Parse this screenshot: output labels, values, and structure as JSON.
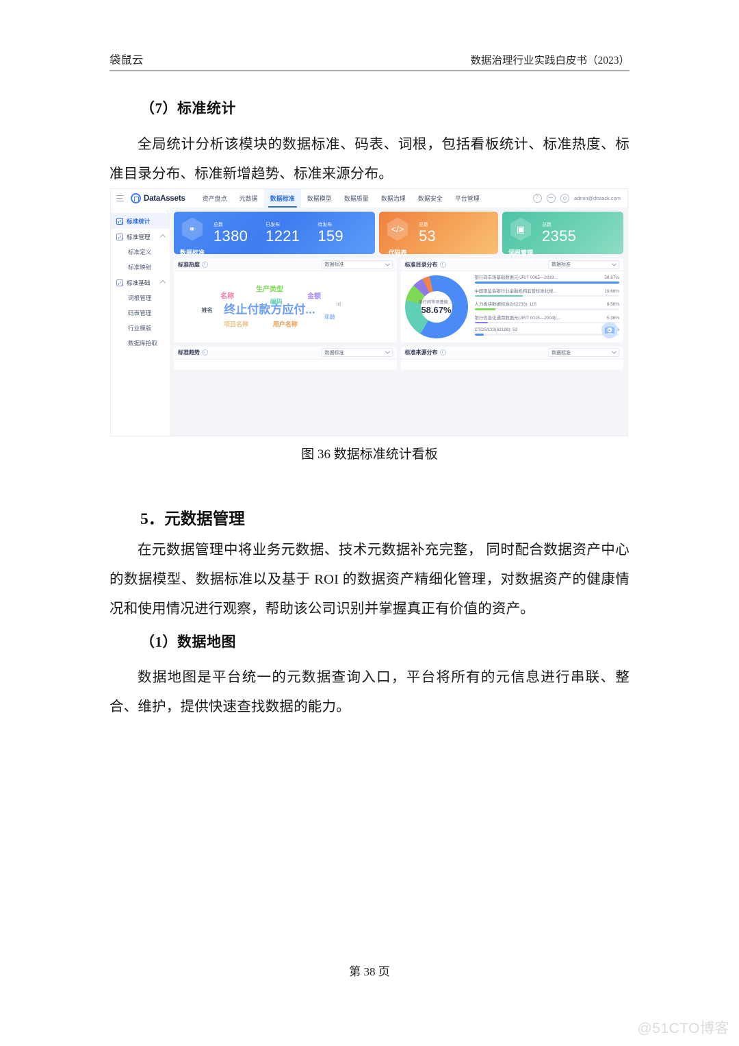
{
  "page": {
    "header_left": "袋鼠云",
    "header_right": "数据治理行业实践白皮书（2023）",
    "footer": "第 38 页",
    "watermark": "@51CTO博客"
  },
  "sections": {
    "sub_heading_7": "（7）标准统计",
    "para_7": "全局统计分析该模块的数据标准、码表、词根，包括看板统计、标准热度、标准目录分布、标准新增趋势、标准来源分布。",
    "figure_caption": "图 36 数据标准统计看板",
    "heading_5": "5．元数据管理",
    "para_5": "在元数据管理中将业务元数据、技术元数据补充完整， 同时配合数据资产中心的数据模型、数据标准以及基于 ROI 的数据资产精细化管理，对数据资产的健康情况和使用情况进行观察，帮助该公司识别并掌握真正有价值的资产。",
    "sub_heading_1": "（1）数据地图",
    "para_1": "数据地图是平台统一的元数据查询入口，平台将所有的元信息进行串联、整合、维护，提供快速查找数据的能力。"
  },
  "app": {
    "brand": "DataAssets",
    "nav_tabs": [
      {
        "label": "资产盘点",
        "active": false
      },
      {
        "label": "元数据",
        "active": false
      },
      {
        "label": "数据标准",
        "active": true
      },
      {
        "label": "数据模型",
        "active": false
      },
      {
        "label": "数据质量",
        "active": false
      },
      {
        "label": "数据治理",
        "active": false
      },
      {
        "label": "数据安全",
        "active": false
      },
      {
        "label": "平台管理",
        "active": false
      }
    ],
    "user_email": "admin@dtstack.com",
    "sidebar": [
      {
        "label": "标准统计",
        "type": "item",
        "active": true
      },
      {
        "label": "标准管理",
        "type": "group",
        "active": false
      },
      {
        "label": "标准定义",
        "type": "sub"
      },
      {
        "label": "标准映射",
        "type": "sub"
      },
      {
        "label": "标准基础",
        "type": "group",
        "active": false
      },
      {
        "label": "词根管理",
        "type": "sub"
      },
      {
        "label": "码表管理",
        "type": "sub"
      },
      {
        "label": "行业模版",
        "type": "sub"
      },
      {
        "label": "数据库拾取",
        "type": "sub"
      }
    ],
    "stat_cards": [
      {
        "title": "数据标准",
        "icon": "standard-hex-icon",
        "color": "#4a8bf5",
        "metrics": [
          {
            "label": "总数",
            "value": "1380"
          },
          {
            "label": "已发布",
            "value": "1221"
          },
          {
            "label": "待发布",
            "value": "159"
          }
        ]
      },
      {
        "title": "代码表",
        "icon": "code-hex-icon",
        "color": "#ef8040",
        "metrics": [
          {
            "label": "总数",
            "value": "53"
          }
        ]
      },
      {
        "title": "词根管理",
        "icon": "word-hex-icon",
        "color": "#4cc3a5",
        "metrics": [
          {
            "label": "总数",
            "value": "2355"
          }
        ]
      }
    ],
    "panels": {
      "heat": {
        "title": "标准热度",
        "select": "数据标准"
      },
      "catalog": {
        "title": "标准目录分布",
        "select": "数据标准"
      },
      "trend": {
        "title": "标准趋势",
        "select": "数据标准"
      },
      "source": {
        "title": "标准来源分布",
        "select": "数据标准"
      }
    }
  },
  "chart_data": [
    {
      "type": "wordcloud",
      "title": "标准热度",
      "words": [
        {
          "text": "终止付款方应付...",
          "weight": 100,
          "color": "#6b9ef5",
          "x": 43,
          "y": 52,
          "size": 17
        },
        {
          "text": "生产类型",
          "weight": 52,
          "color": "#7ed957",
          "x": 43,
          "y": 24,
          "size": 10
        },
        {
          "text": "名称",
          "weight": 46,
          "color": "#f07b9a",
          "x": 24,
          "y": 34,
          "size": 10
        },
        {
          "text": "金额",
          "weight": 44,
          "color": "#a78bf0",
          "x": 63,
          "y": 34,
          "size": 10
        },
        {
          "text": "编码",
          "weight": 40,
          "color": "#5fd0b5",
          "x": 46,
          "y": 42,
          "size": 9
        },
        {
          "text": "用户名称",
          "weight": 36,
          "color": "#f09a4a",
          "x": 50,
          "y": 74,
          "size": 9
        },
        {
          "text": "项目名称",
          "weight": 34,
          "color": "#e8c389",
          "x": 28,
          "y": 74,
          "size": 9
        },
        {
          "text": "年龄",
          "weight": 28,
          "color": "#8fb6f5",
          "x": 70,
          "y": 64,
          "size": 8
        },
        {
          "text": "姓名",
          "weight": 26,
          "color": "#4a5568",
          "x": 15,
          "y": 55,
          "size": 8
        },
        {
          "text": "id",
          "weight": 22,
          "color": "#b7bdc9",
          "x": 74,
          "y": 46,
          "size": 8
        }
      ]
    },
    {
      "type": "pie",
      "title": "标准目录分布",
      "center_label": "银行间市场基础数...",
      "center_value": "58.67%",
      "slices": [
        {
          "name": "银行间市场基础数据元(JR/T 0065—2019...",
          "percent": 58.67,
          "color": "#4a8bf5"
        },
        {
          "name": "中国银监会银行业金融机构监管标准化规...",
          "percent": 19.66,
          "color": "#5fd0b5"
        },
        {
          "name": "人力板块数据标准2(62233): 115",
          "percent": 8.56,
          "color": "#7ed957"
        },
        {
          "name": "银行信息化通用数据元(JR/T 0015—2004)(...",
          "percent": 5.36,
          "color": "#8b7ae8"
        },
        {
          "name": "CTOS/CIS(62198): 52",
          "percent": 3.87,
          "color": "#4a8bf5"
        }
      ]
    }
  ]
}
